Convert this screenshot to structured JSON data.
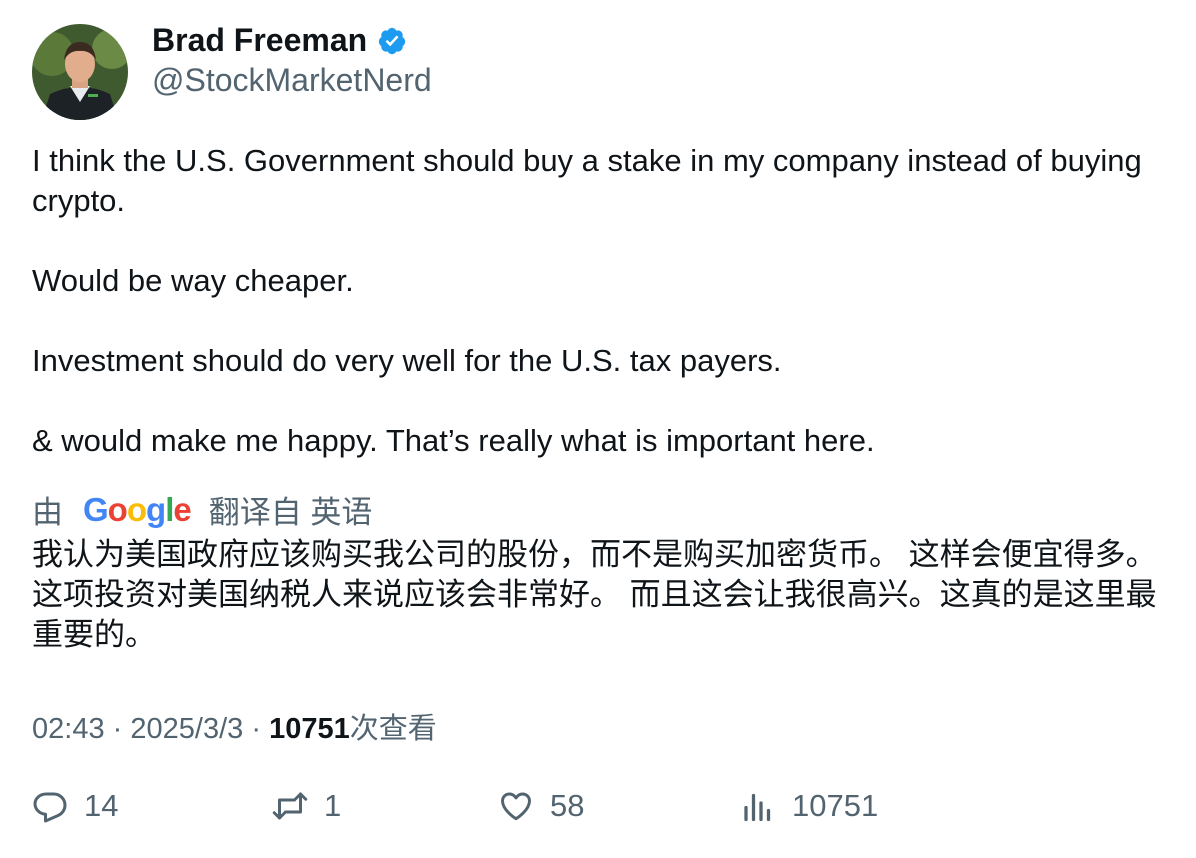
{
  "author": {
    "name": "Brad Freeman",
    "handle": "@StockMarketNerd",
    "verified_badge_color": "#1d9bf0"
  },
  "tweet": {
    "paragraphs": [
      "I think the U.S. Government should buy a stake in my company instead of buying crypto.",
      "Would be way cheaper.",
      "Investment should do very well for the U.S. tax payers.",
      "& would make me happy. That’s really what is important here."
    ]
  },
  "translation": {
    "prefix": "由",
    "provider": "Google",
    "suffix": "翻译自 英语",
    "text": "我认为美国政府应该购买我公司的股份，而不是购买加密货币。 这样会便宜得多。 这项投资对美国纳税人来说应该会非常好。 而且这会让我很高兴。这真的是这里最重要的。"
  },
  "meta": {
    "time": "02:43",
    "separator": "·",
    "date": "2025/3/3",
    "views_count": "10751",
    "views_label": "次查看"
  },
  "actions": {
    "replies": "14",
    "retweets": "1",
    "likes": "58",
    "views": "10751"
  },
  "icons": {
    "reply": "reply-icon",
    "retweet": "retweet-icon",
    "like": "heart-icon",
    "views": "views-bar-icon"
  }
}
